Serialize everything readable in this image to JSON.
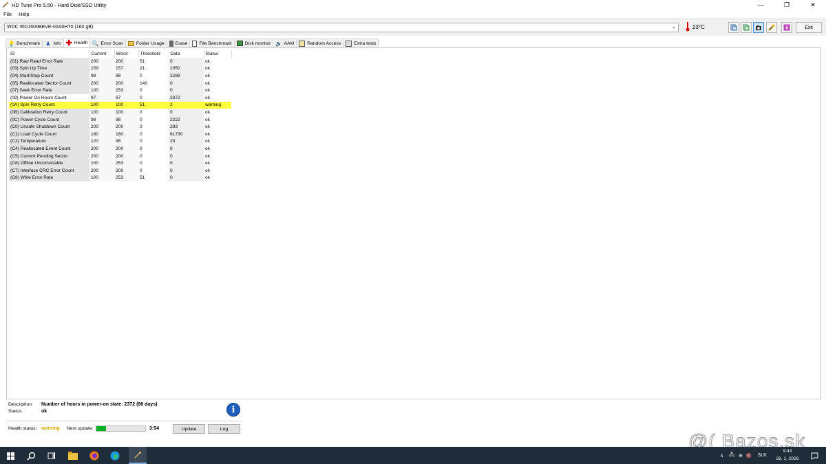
{
  "window": {
    "title": "HD Tune Pro 5.50 - Hard Disk/SSD Utility",
    "minimize": "—",
    "restore": "❐",
    "close": "✕"
  },
  "menu": [
    "File",
    "Help"
  ],
  "toolbar": {
    "drive": "WDC WD1600BEVE-00A0HT0 (160 gB)",
    "temperature": "23°C",
    "exit_label": "Exit"
  },
  "tabs": [
    {
      "label": "Benchmark",
      "icon": "bulb-icon"
    },
    {
      "label": "Info",
      "icon": "info-person-icon"
    },
    {
      "label": "Health",
      "icon": "health-cross-icon",
      "active": true
    },
    {
      "label": "Error Scan",
      "icon": "magnifier-icon"
    },
    {
      "label": "Folder Usage",
      "icon": "folder-icon"
    },
    {
      "label": "Erase",
      "icon": "trash-icon"
    },
    {
      "label": "File Benchmark",
      "icon": "file-icon"
    },
    {
      "label": "Disk monitor",
      "icon": "monitor-icon"
    },
    {
      "label": "AAM",
      "icon": "speaker-icon"
    },
    {
      "label": "Random Access",
      "icon": "random-icon"
    },
    {
      "label": "Extra tests",
      "icon": "extra-icon"
    }
  ],
  "table": {
    "headers": [
      "ID",
      "Current",
      "Worst",
      "Threshold",
      "Data",
      "Status"
    ],
    "rows": [
      [
        "(01) Raw Read Error Rate",
        "200",
        "200",
        "51",
        "0",
        "ok"
      ],
      [
        "(03) Spin Up Time",
        "159",
        "157",
        "21",
        "1050",
        "ok"
      ],
      [
        "(04) Start/Stop Count",
        "98",
        "98",
        "0",
        "2289",
        "ok"
      ],
      [
        "(05) Reallocated Sector Count",
        "200",
        "200",
        "140",
        "0",
        "ok"
      ],
      [
        "(07) Seek Error Rate",
        "100",
        "253",
        "0",
        "0",
        "ok"
      ],
      [
        "(09) Power On Hours Count",
        "97",
        "97",
        "0",
        "2372",
        "ok"
      ],
      [
        "(0A) Spin Retry Count",
        "100",
        "100",
        "51",
        "2",
        "warning"
      ],
      [
        "(0B) Calibration Retry Count",
        "100",
        "100",
        "0",
        "0",
        "ok"
      ],
      [
        "(0C) Power Cycle Count",
        "98",
        "98",
        "0",
        "2222",
        "ok"
      ],
      [
        "(C0) Unsafe Shutdown Count",
        "200",
        "200",
        "0",
        "293",
        "ok"
      ],
      [
        "(C1) Load Cycle Count",
        "180",
        "180",
        "0",
        "61730",
        "ok"
      ],
      [
        "(C2) Temperature",
        "120",
        "98",
        "0",
        "23",
        "ok"
      ],
      [
        "(C4) Reallocated Event Count",
        "200",
        "200",
        "0",
        "0",
        "ok"
      ],
      [
        "(C5) Current Pending Sector",
        "200",
        "200",
        "0",
        "0",
        "ok"
      ],
      [
        "(C6) Offline Uncorrectable",
        "100",
        "253",
        "0",
        "0",
        "ok"
      ],
      [
        "(C7) Interface CRC Error Count",
        "200",
        "200",
        "0",
        "0",
        "ok"
      ],
      [
        "(C8) Write Error Rate",
        "100",
        "253",
        "51",
        "0",
        "ok"
      ]
    ]
  },
  "details": {
    "description_label": "Description:",
    "description_value": "Number of hours in power-on state: 2372 (98 days)",
    "status_label": "Status:",
    "status_value": "ok"
  },
  "health": {
    "label": "Health status:",
    "value": "warning",
    "next_update_label": "Next update:",
    "progress_fraction": 0.2,
    "timer": "3:54",
    "update_label": "Update",
    "log_label": "Log"
  },
  "watermark": "@( Bazos.sk",
  "taskbar": {
    "language": "SLK",
    "time": "9:43",
    "date": "28. 1. 2026"
  },
  "colors": {
    "warning_row": "#ffff3c",
    "health_warning_text": "#e0a800",
    "progress_fill": "#06b025",
    "taskbar": "#1f2d3a"
  }
}
